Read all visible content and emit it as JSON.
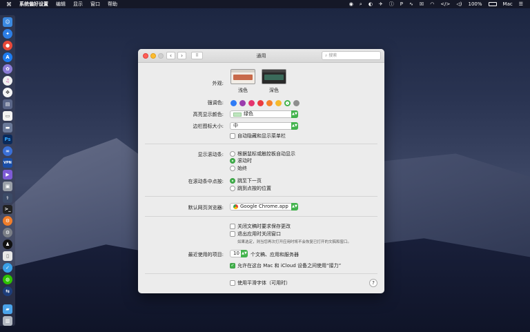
{
  "menubar": {
    "apple": "",
    "app_name": "系统偏好设置",
    "menus": [
      "编辑",
      "显示",
      "窗口",
      "帮助"
    ],
    "battery": "100%",
    "user": "Mac"
  },
  "window": {
    "title": "通用",
    "search_placeholder": "搜索",
    "nav_back": "‹",
    "nav_forward": "›",
    "grid": "⠿"
  },
  "appearance": {
    "label": "外观:",
    "light": "浅色",
    "dark": "深色"
  },
  "accent": {
    "label": "强调色:",
    "colors": [
      "#2f7cf6",
      "#9b3dae",
      "#e4356f",
      "#ea3a3f",
      "#f5802a",
      "#f6b92b",
      "#43b34d",
      "#8e8e8e"
    ]
  },
  "highlight": {
    "label": "高亮显示颜色:",
    "value": "绿色"
  },
  "sidebar_icon": {
    "label": "边栏图标大小:",
    "value": "中"
  },
  "menubar_autohide": "自动隐藏和显示菜单栏",
  "scrollbars": {
    "label": "显示滚动条:",
    "opt1": "根据鼠标或触控板自动显示",
    "opt2": "滚动时",
    "opt3": "始终"
  },
  "click_scroll": {
    "label": "在滚动条中点按:",
    "opt1": "跳至下一页",
    "opt2": "跳到点按的位置"
  },
  "browser": {
    "label": "默认网页浏览器:",
    "value": "Google Chrome.app"
  },
  "ask_save": "关闭文稿时要求保存更改",
  "close_windows": "退出应用时关闭窗口",
  "close_note": "如果选定，则当您再次打开应用时将不会恢复已打开的文稿和窗口。",
  "recent": {
    "label": "最近使用的项目:",
    "value": "10",
    "suffix": "个文稿、应用和服务器"
  },
  "handoff": "允许在这台 Mac 和 iCloud 设备之间使用“接力”",
  "font_smooth": "使用平滑字体（可用时）",
  "help": "?"
}
